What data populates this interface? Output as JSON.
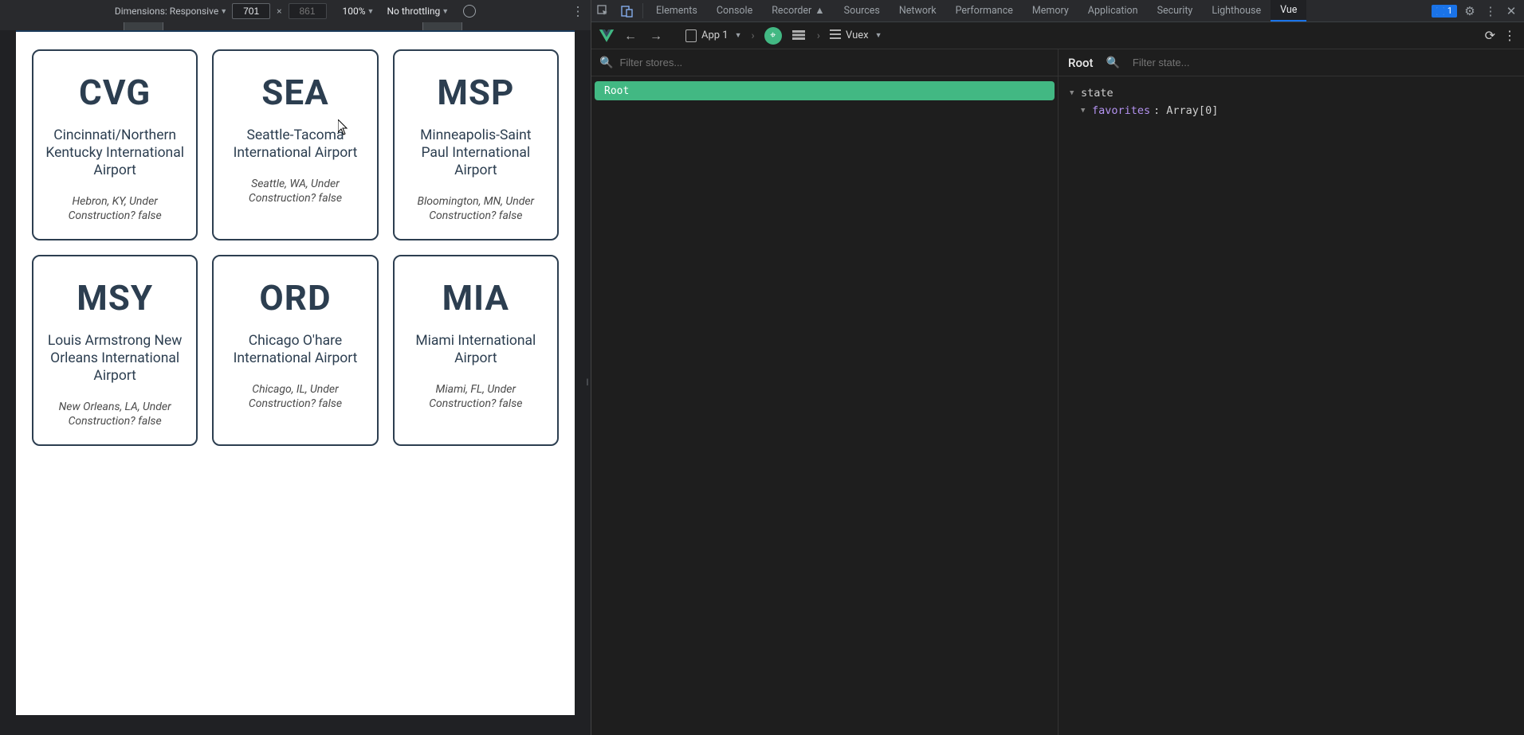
{
  "deviceToolbar": {
    "dimensionsLabel": "Dimensions: Responsive",
    "widthValue": "701",
    "heightPlaceholder": "861",
    "zoom": "100%",
    "throttling": "No throttling"
  },
  "page": {
    "cards": [
      {
        "code": "CVG",
        "name": "Cincinnati/Northern Kentucky International Airport",
        "loc": "Hebron, KY, Under Construction? false"
      },
      {
        "code": "SEA",
        "name": "Seattle-Tacoma International Airport",
        "loc": "Seattle, WA, Under Construction? false"
      },
      {
        "code": "MSP",
        "name": "Minneapolis-Saint Paul International Airport",
        "loc": "Bloomington, MN, Under Construction? false"
      },
      {
        "code": "MSY",
        "name": "Louis Armstrong New Orleans International Airport",
        "loc": "New Orleans, LA, Under Construction? false"
      },
      {
        "code": "ORD",
        "name": "Chicago O'hare International Airport",
        "loc": "Chicago, IL, Under Construction? false"
      },
      {
        "code": "MIA",
        "name": "Miami International Airport",
        "loc": "Miami, FL, Under Construction? false"
      }
    ]
  },
  "devtools": {
    "tabs": [
      "Elements",
      "Console",
      "Recorder",
      "Sources",
      "Network",
      "Performance",
      "Memory",
      "Application",
      "Security",
      "Lighthouse",
      "Vue"
    ],
    "activeTab": "Vue",
    "issuesBadge": "1"
  },
  "vue": {
    "appLabel": "App 1",
    "inspectorLabel": "Vuex",
    "filterStoresPlaceholder": "Filter stores...",
    "filterStatePlaceholder": "Filter state...",
    "treeRoot": "Root",
    "stateTitle": "Root",
    "stateRootKey": "state",
    "favoritesKey": "favorites",
    "favoritesValue": "Array[0]"
  }
}
